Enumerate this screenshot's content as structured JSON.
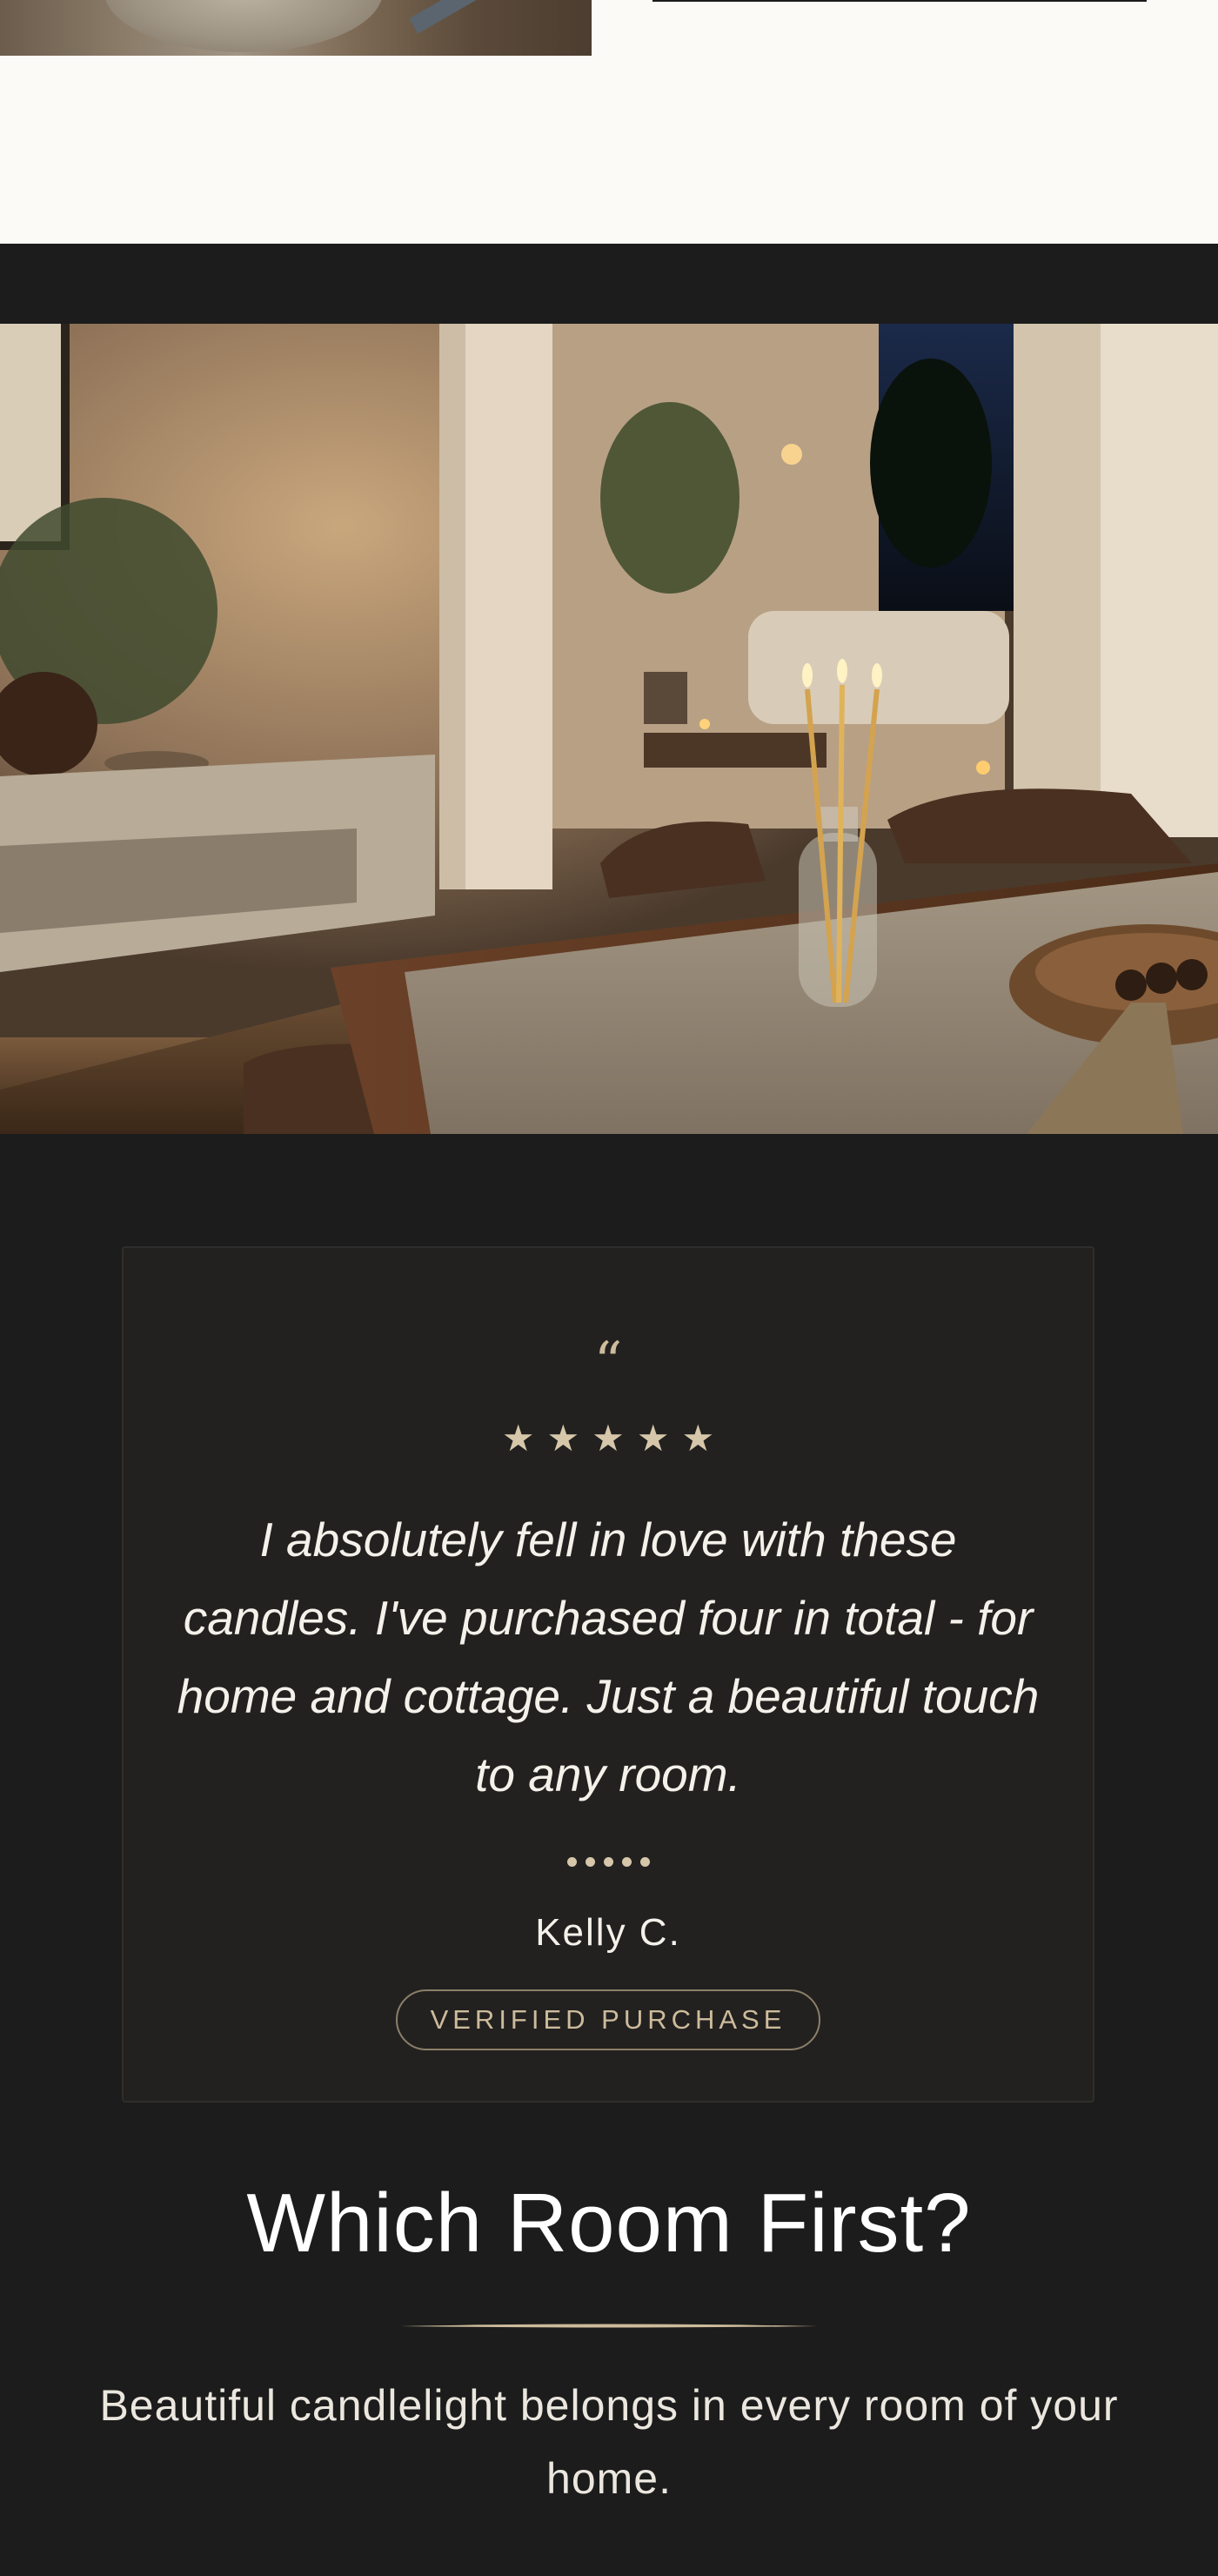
{
  "top": {
    "background_color": "#fbfaf7"
  },
  "testimonial": {
    "quote_mark": "“",
    "rating": 5,
    "rating_max": 5,
    "star_icon": "star-icon",
    "text": "I absolutely fell in love with these candles. I've purchased four in total - for home and cottage. Just a beautiful touch to any room.",
    "carousel_dots": 5,
    "reviewer": "Kelly C.",
    "badge": "VERIFIED PURCHASE"
  },
  "section": {
    "title": "Which Room First?",
    "subtitle": "Beautiful candlelight belongs in every room of your home."
  },
  "colors": {
    "dark_background": "#1c1c1c",
    "card_background": "#222120",
    "accent_gold": "#d6c7aa",
    "text_light": "#f4f1ea"
  }
}
